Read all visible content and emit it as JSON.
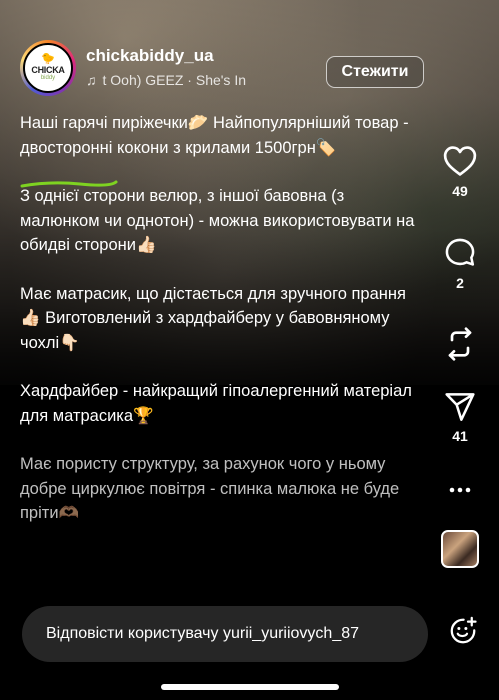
{
  "header": {
    "avatar": {
      "brand": "CHICKA",
      "sub": "biddy"
    },
    "username": "chickabiddy_ua",
    "music": "t Ooh)   GEEZ · She's In",
    "follow_label": "Стежити"
  },
  "caption": {
    "paragraphs": [
      "Наші гарячі пиріжечки🥟 Найпопулярніший товар - двосторонні кокони з крилами 1500грн🏷️",
      "З однієї сторони велюр, з іншої бавовна (з малюнком чи однотон) - можна використовувати на обидві сторони👍🏻",
      "Має матрасик, що дістається для зручного прання👍🏻 Виготовлений з хардфайберу у бавовняному чохлі👇🏻",
      "Хардфайбер - найкращий гіпоалергенний матеріал для матрасика🏆",
      "Має пористу структуру, за рахунок чого у ньому добре циркулює повітря - спинка малюка не буде пріти🫶🏽"
    ]
  },
  "rail": {
    "likes": "49",
    "comments": "2",
    "shares": "41"
  },
  "reply": {
    "placeholder": "Відповісти користувачу yurii_yuriiovych_87"
  },
  "icons": {
    "like": "heart-icon",
    "comment": "comment-icon",
    "repost": "repost-icon",
    "share": "send-icon",
    "more": "more-icon",
    "emoji": "emoji-add-icon",
    "music": "music-note-icon"
  },
  "colors": {
    "background": "#000000",
    "reply_box": "#262626",
    "underline": "#7ed321"
  }
}
